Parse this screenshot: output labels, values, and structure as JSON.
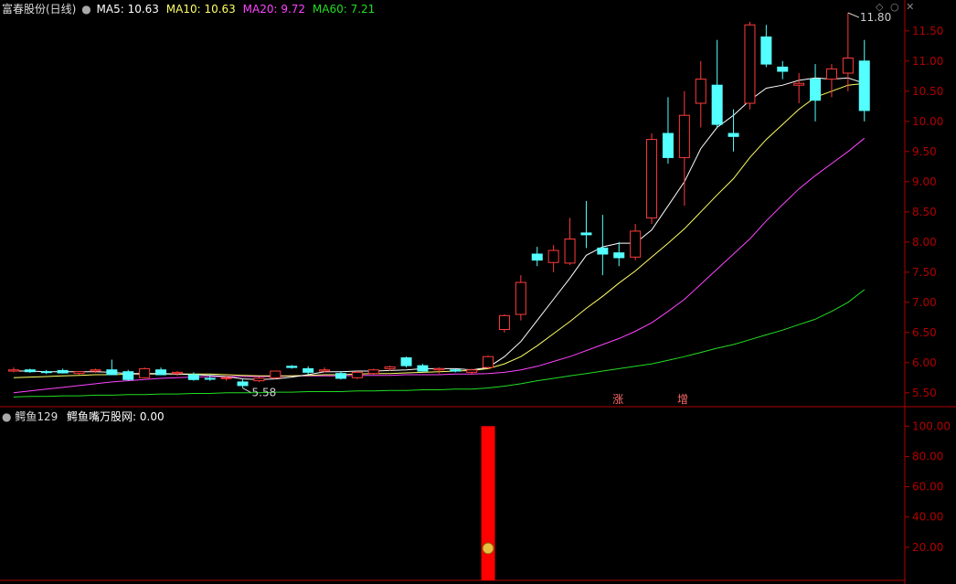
{
  "main_header": {
    "title": "富春股份(日线)",
    "ma5_label": "MA5: 10.63",
    "ma10_label": "MA10: 10.63",
    "ma20_label": "MA20: 9.72",
    "ma60_label": "MA60: 7.21"
  },
  "sub_header": {
    "title": "鳄鱼129",
    "indicator_label": "鳄鱼嘴万股网: 0.00"
  },
  "colors": {
    "bg": "#000000",
    "axis": "#b00000",
    "up": "#ff3b3b",
    "down": "#54ffff",
    "ma5": "#ffffff",
    "ma10": "#ffff66",
    "ma20": "#ff44ff",
    "ma60": "#22dd22",
    "label_gray": "#cccccc"
  },
  "chart_data": [
    {
      "type": "candlestick",
      "ylim": [
        5.3,
        11.8
      ],
      "yticks": [
        "5.50",
        "6.00",
        "6.50",
        "7.00",
        "7.50",
        "8.00",
        "8.50",
        "9.00",
        "9.50",
        "10.00",
        "10.50",
        "11.00",
        "11.50"
      ],
      "ohlc": [
        [
          5.86,
          5.92,
          5.84,
          5.88
        ],
        [
          5.88,
          5.9,
          5.83,
          5.85
        ],
        [
          5.85,
          5.88,
          5.81,
          5.84
        ],
        [
          5.87,
          5.9,
          5.82,
          5.83
        ],
        [
          5.82,
          5.86,
          5.8,
          5.85
        ],
        [
          5.86,
          5.9,
          5.83,
          5.88
        ],
        [
          5.88,
          6.05,
          5.85,
          5.8
        ],
        [
          5.85,
          5.88,
          5.7,
          5.72
        ],
        [
          5.75,
          5.92,
          5.74,
          5.9
        ],
        [
          5.88,
          5.92,
          5.82,
          5.8
        ],
        [
          5.82,
          5.86,
          5.78,
          5.84
        ],
        [
          5.8,
          5.84,
          5.7,
          5.72
        ],
        [
          5.74,
          5.8,
          5.7,
          5.73
        ],
        [
          5.75,
          5.8,
          5.7,
          5.75
        ],
        [
          5.68,
          5.72,
          5.58,
          5.62
        ],
        [
          5.7,
          5.76,
          5.68,
          5.74
        ],
        [
          5.75,
          5.86,
          5.73,
          5.86
        ],
        [
          5.94,
          5.96,
          5.9,
          5.92
        ],
        [
          5.9,
          5.94,
          5.8,
          5.84
        ],
        [
          5.86,
          5.92,
          5.84,
          5.88
        ],
        [
          5.82,
          5.86,
          5.72,
          5.74
        ],
        [
          5.75,
          5.86,
          5.73,
          5.84
        ],
        [
          5.82,
          5.9,
          5.8,
          5.88
        ],
        [
          5.9,
          5.95,
          5.86,
          5.93
        ],
        [
          6.08,
          6.1,
          5.92,
          5.95
        ],
        [
          5.95,
          5.98,
          5.85,
          5.86
        ],
        [
          5.88,
          5.92,
          5.82,
          5.9
        ],
        [
          5.88,
          5.9,
          5.84,
          5.86
        ],
        [
          5.84,
          5.9,
          5.8,
          5.88
        ],
        [
          5.92,
          6.12,
          5.9,
          6.1
        ],
        [
          6.55,
          6.8,
          6.5,
          6.78
        ],
        [
          6.8,
          7.45,
          6.7,
          7.33
        ],
        [
          7.8,
          7.92,
          7.6,
          7.7
        ],
        [
          7.66,
          7.95,
          7.5,
          7.86
        ],
        [
          7.65,
          8.4,
          7.62,
          8.05
        ],
        [
          8.15,
          8.68,
          7.9,
          8.12
        ],
        [
          7.9,
          8.45,
          7.45,
          7.8
        ],
        [
          7.82,
          8.0,
          7.6,
          7.74
        ],
        [
          7.75,
          8.3,
          7.7,
          8.18
        ],
        [
          8.4,
          9.8,
          8.3,
          9.7
        ],
        [
          9.8,
          10.4,
          9.3,
          9.4
        ],
        [
          9.4,
          10.5,
          8.6,
          10.1
        ],
        [
          10.3,
          11.0,
          9.9,
          10.7
        ],
        [
          10.6,
          11.35,
          9.9,
          9.95
        ],
        [
          9.8,
          10.2,
          9.5,
          9.75
        ],
        [
          10.3,
          11.65,
          10.2,
          11.6
        ],
        [
          11.4,
          11.6,
          10.9,
          10.95
        ],
        [
          10.9,
          11.0,
          10.7,
          10.83
        ],
        [
          10.6,
          10.8,
          10.3,
          10.63
        ],
        [
          10.7,
          10.95,
          10.0,
          10.35
        ],
        [
          10.7,
          10.95,
          10.4,
          10.87
        ],
        [
          10.8,
          11.8,
          10.5,
          11.05
        ],
        [
          11.0,
          11.35,
          10.0,
          10.18
        ]
      ],
      "ma5": [
        5.86,
        5.86,
        5.85,
        5.85,
        5.85,
        5.85,
        5.84,
        5.82,
        5.82,
        5.82,
        5.81,
        5.8,
        5.79,
        5.77,
        5.73,
        5.72,
        5.73,
        5.76,
        5.8,
        5.85,
        5.85,
        5.86,
        5.86,
        5.87,
        5.88,
        5.9,
        5.9,
        5.9,
        5.88,
        5.92,
        6.1,
        6.35,
        6.7,
        7.05,
        7.4,
        7.78,
        7.92,
        7.98,
        7.98,
        8.2,
        8.6,
        9.0,
        9.55,
        9.9,
        10.1,
        10.35,
        10.55,
        10.6,
        10.68,
        10.72,
        10.7,
        10.72,
        10.63
      ],
      "ma10": [
        5.75,
        5.76,
        5.77,
        5.78,
        5.79,
        5.8,
        5.8,
        5.81,
        5.81,
        5.81,
        5.81,
        5.81,
        5.81,
        5.8,
        5.79,
        5.78,
        5.78,
        5.78,
        5.79,
        5.8,
        5.8,
        5.81,
        5.82,
        5.82,
        5.83,
        5.84,
        5.85,
        5.86,
        5.87,
        5.9,
        5.98,
        6.1,
        6.28,
        6.48,
        6.68,
        6.9,
        7.1,
        7.32,
        7.52,
        7.75,
        7.98,
        8.22,
        8.5,
        8.78,
        9.05,
        9.4,
        9.7,
        9.95,
        10.2,
        10.4,
        10.5,
        10.6,
        10.63
      ],
      "ma20": [
        5.5,
        5.53,
        5.56,
        5.59,
        5.62,
        5.65,
        5.68,
        5.7,
        5.72,
        5.74,
        5.75,
        5.76,
        5.77,
        5.77,
        5.77,
        5.77,
        5.77,
        5.78,
        5.78,
        5.78,
        5.78,
        5.79,
        5.79,
        5.79,
        5.8,
        5.8,
        5.8,
        5.81,
        5.81,
        5.82,
        5.84,
        5.88,
        5.94,
        6.02,
        6.1,
        6.2,
        6.3,
        6.4,
        6.52,
        6.66,
        6.85,
        7.05,
        7.3,
        7.55,
        7.8,
        8.05,
        8.35,
        8.62,
        8.88,
        9.1,
        9.3,
        9.5,
        9.72
      ],
      "ma60": [
        5.43,
        5.44,
        5.44,
        5.45,
        5.45,
        5.46,
        5.46,
        5.47,
        5.47,
        5.48,
        5.48,
        5.49,
        5.49,
        5.5,
        5.5,
        5.5,
        5.51,
        5.51,
        5.52,
        5.52,
        5.52,
        5.53,
        5.53,
        5.54,
        5.54,
        5.55,
        5.55,
        5.56,
        5.56,
        5.58,
        5.61,
        5.65,
        5.7,
        5.74,
        5.78,
        5.82,
        5.86,
        5.9,
        5.94,
        5.98,
        6.04,
        6.1,
        6.17,
        6.24,
        6.3,
        6.38,
        6.46,
        6.54,
        6.63,
        6.72,
        6.85,
        7.0,
        7.21
      ],
      "annotations": {
        "high_label": "11.80",
        "low_label": "5.58"
      },
      "signal_markers": [
        "涨",
        "增"
      ]
    },
    {
      "type": "bar",
      "ylim": [
        0,
        105
      ],
      "yticks": [
        "20.00",
        "40.00",
        "60.00",
        "80.00",
        "100.00"
      ],
      "values": [
        0,
        0,
        0,
        0,
        0,
        0,
        0,
        0,
        0,
        0,
        0,
        0,
        0,
        0,
        0,
        0,
        0,
        0,
        0,
        0,
        0,
        0,
        0,
        0,
        0,
        0,
        0,
        0,
        0,
        100,
        0,
        0,
        0,
        0,
        0,
        0,
        0,
        0,
        0,
        0,
        0,
        0,
        0,
        0,
        0,
        0,
        0,
        0,
        0,
        0,
        0,
        0,
        0
      ]
    }
  ]
}
